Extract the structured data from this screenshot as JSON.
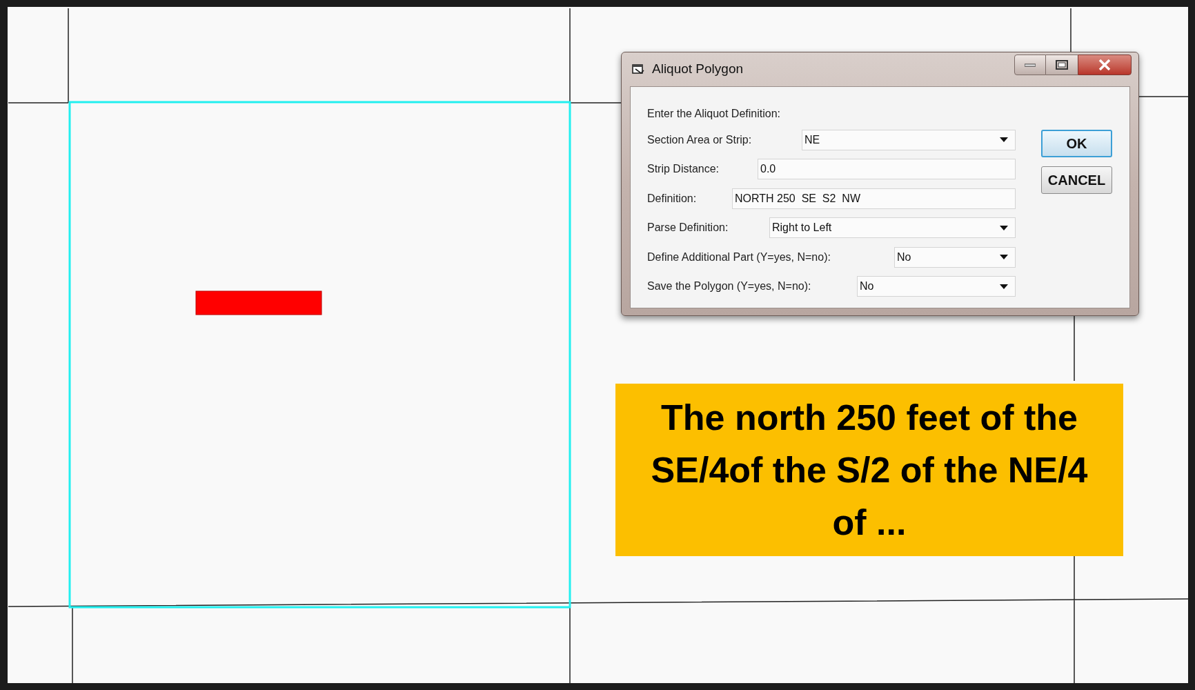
{
  "window": {
    "title": "Aliquot Polygon"
  },
  "dialog": {
    "prompt": "Enter the Aliquot Definition:",
    "fields": [
      {
        "kind": "dropdown",
        "label": "Section Area or Strip:",
        "value": "NE"
      },
      {
        "kind": "text",
        "label": "Strip Distance:",
        "value": "0.0"
      },
      {
        "kind": "text",
        "label": "Definition:",
        "value": "NORTH 250  SE  S2  NW"
      },
      {
        "kind": "dropdown",
        "label": "Parse Definition:",
        "value": "Right to Left"
      },
      {
        "kind": "dropdown",
        "label": "Define Additional Part (Y=yes, N=no):",
        "value": "No"
      },
      {
        "kind": "dropdown",
        "label": "Save the Polygon (Y=yes, N=no):",
        "value": "No"
      }
    ],
    "buttons": [
      {
        "label": "OK",
        "default": true
      },
      {
        "label": "CANCEL",
        "default": false
      }
    ]
  },
  "caption": {
    "text": "The north 250 feet of the SE/4of the S/2 of the NE/4 of ..."
  }
}
